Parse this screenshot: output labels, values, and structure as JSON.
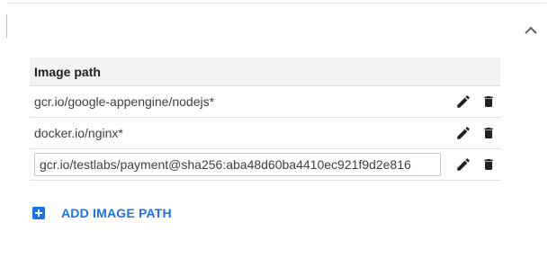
{
  "panel": {
    "collapse_icon": "chevron-up-icon"
  },
  "table": {
    "header": "Image path",
    "rows": [
      {
        "path": "gcr.io/google-appengine/nodejs*",
        "editing": false
      },
      {
        "path": "docker.io/nginx*",
        "editing": false
      },
      {
        "path": "gcr.io/testlabs/payment@sha256:aba48d60ba4410ec921f9d2e816",
        "editing": true
      }
    ],
    "row_actions": [
      "pencil-icon",
      "trash-icon"
    ]
  },
  "add_button": {
    "label": "ADD IMAGE PATH",
    "icon": "plus-box-icon"
  },
  "colors": {
    "accent": "#1a73e8",
    "header_bg": "#f1f3f4",
    "text": "#202124",
    "icon": "#202124"
  }
}
